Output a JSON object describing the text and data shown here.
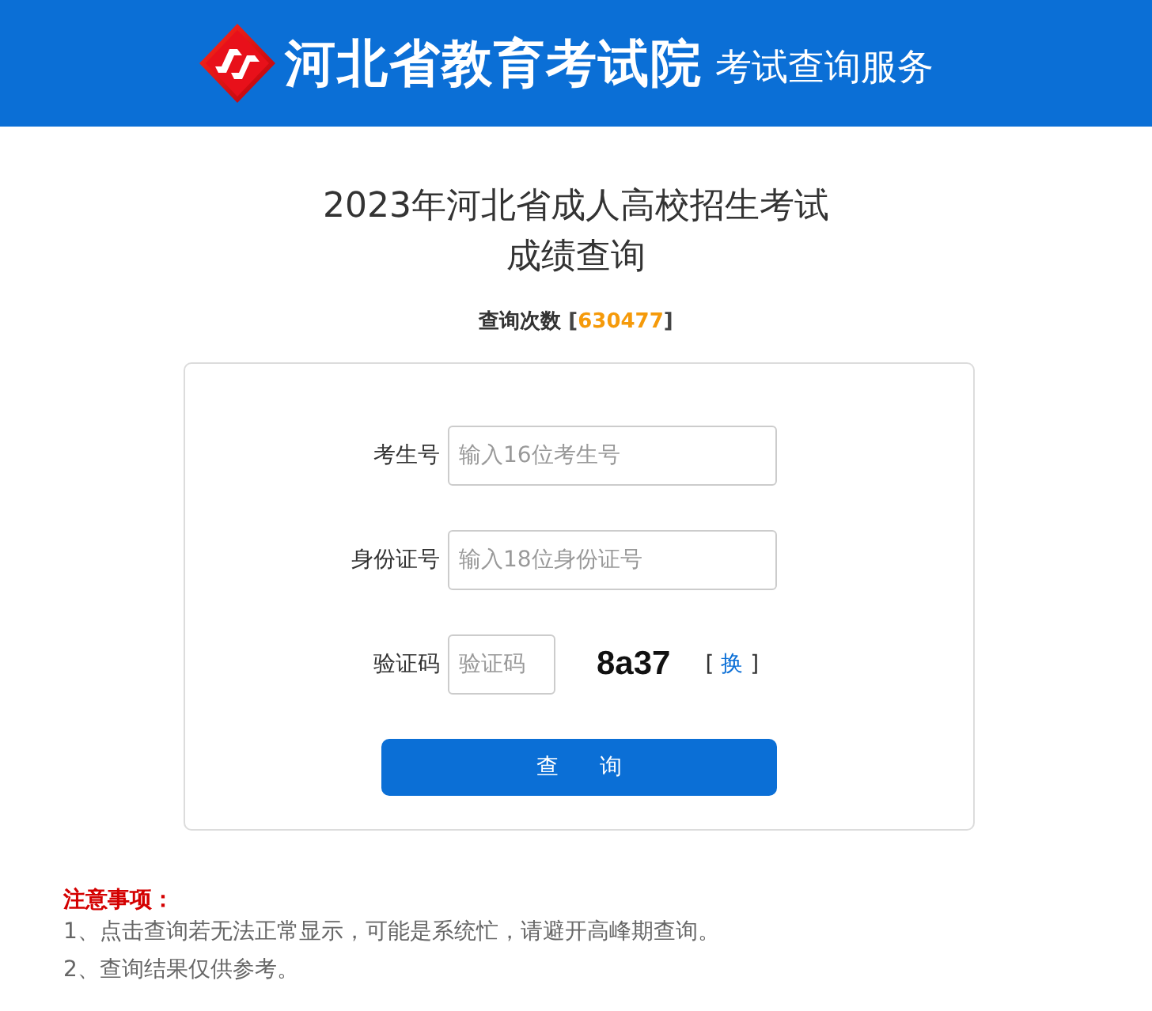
{
  "header": {
    "title": "河北省教育考试院",
    "subtitle": "考试查询服务"
  },
  "heading": {
    "title": "2023年河北省成人高校招生考试",
    "subtitle": "成绩查询",
    "counter": {
      "label": "查询次数",
      "brackets": [
        "[",
        "]"
      ],
      "value": "630477"
    }
  },
  "form": {
    "fields": [
      {
        "kind": "text",
        "label": "考生号",
        "placeholder": "输入16位考生号"
      },
      {
        "kind": "text",
        "label": "身份证号",
        "placeholder": "输入18位身份证号"
      },
      {
        "kind": "captcha",
        "label": "验证码",
        "placeholder": "验证码",
        "code": "8a37",
        "refresh": {
          "brackets": [
            "[",
            "]"
          ],
          "label": "换"
        }
      }
    ],
    "submit": "查　询"
  },
  "notice": {
    "title": "注意事项：",
    "items": [
      "1、点击查询若无法正常显示，可能是系统忙，请避开高峰期查询。",
      "2、查询结果仅供参考。"
    ]
  }
}
